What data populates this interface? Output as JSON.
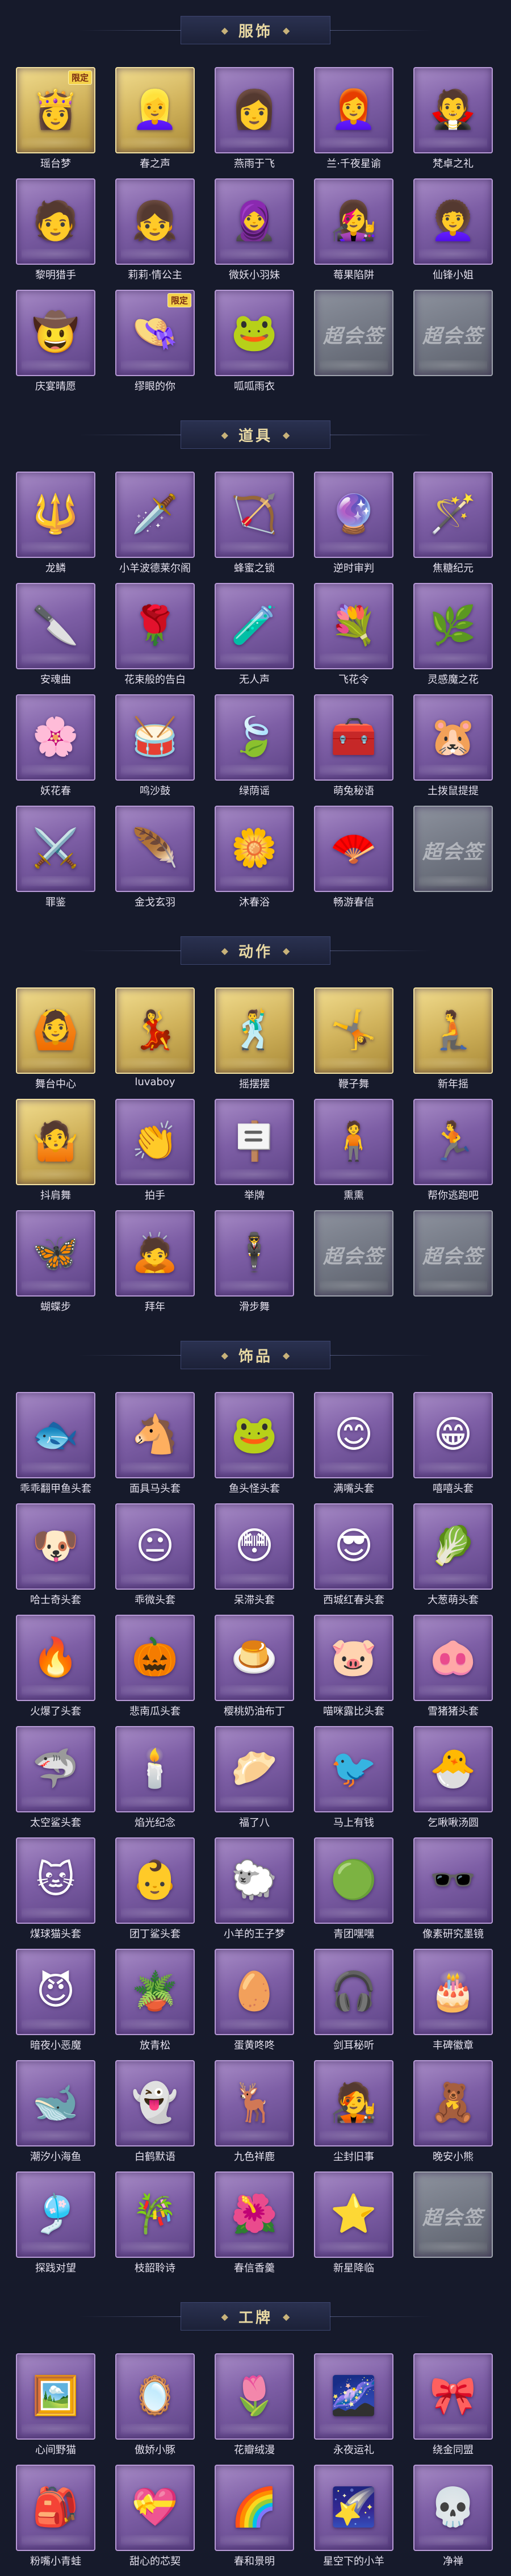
{
  "sections": [
    {
      "title": "服饰",
      "items": [
        {
          "label": "瑶台梦",
          "tier": "gold",
          "badge": "限定",
          "glyph": "👸"
        },
        {
          "label": "春之声",
          "tier": "gold",
          "badge": "",
          "glyph": "👱‍♀️"
        },
        {
          "label": "燕雨于飞",
          "tier": "purple",
          "badge": "",
          "glyph": "👩"
        },
        {
          "label": "兰·千夜星谕",
          "tier": "purple",
          "badge": "",
          "glyph": "👩‍🦰"
        },
        {
          "label": "梵卓之礼",
          "tier": "purple",
          "badge": "",
          "glyph": "🧛"
        },
        {
          "label": "黎明猎手",
          "tier": "purple",
          "badge": "",
          "glyph": "🧑"
        },
        {
          "label": "莉莉·情公主",
          "tier": "purple",
          "badge": "",
          "glyph": "👧"
        },
        {
          "label": "微妖小羽妹",
          "tier": "purple",
          "badge": "",
          "glyph": "🧕"
        },
        {
          "label": "莓果陷阱",
          "tier": "purple",
          "badge": "",
          "glyph": "👩‍🎤"
        },
        {
          "label": "仙锋小姐",
          "tier": "purple",
          "badge": "",
          "glyph": "👩‍🦱"
        },
        {
          "label": "庆宴晴愿",
          "tier": "purple",
          "badge": "",
          "glyph": "🤠"
        },
        {
          "label": "缪眼的你",
          "tier": "purple",
          "badge": "限定",
          "glyph": "👒"
        },
        {
          "label": "呱呱雨衣",
          "tier": "purple",
          "badge": "",
          "glyph": "🐸"
        },
        {
          "label": "",
          "tier": "empty",
          "badge": "",
          "glyph": ""
        },
        {
          "label": "",
          "tier": "empty",
          "badge": "",
          "glyph": ""
        }
      ]
    },
    {
      "title": "道具",
      "items": [
        {
          "label": "龙鳞",
          "tier": "purple",
          "badge": "",
          "glyph": "🔱"
        },
        {
          "label": "小羊波德莱尔阁",
          "tier": "purple",
          "badge": "",
          "glyph": "🗡️"
        },
        {
          "label": "蜂蜜之锁",
          "tier": "purple",
          "badge": "",
          "glyph": "🏹"
        },
        {
          "label": "逆时审判",
          "tier": "purple",
          "badge": "",
          "glyph": "🔮"
        },
        {
          "label": "焦糖纪元",
          "tier": "purple",
          "badge": "",
          "glyph": "🪄"
        },
        {
          "label": "安魂曲",
          "tier": "purple",
          "badge": "",
          "glyph": "🔪"
        },
        {
          "label": "花束般的告白",
          "tier": "purple",
          "badge": "",
          "glyph": "🌹"
        },
        {
          "label": "无人声",
          "tier": "purple",
          "badge": "",
          "glyph": "🧪"
        },
        {
          "label": "飞花令",
          "tier": "purple",
          "badge": "",
          "glyph": "💐"
        },
        {
          "label": "灵感魔之花",
          "tier": "purple",
          "badge": "",
          "glyph": "🌿"
        },
        {
          "label": "妖花春",
          "tier": "purple",
          "badge": "",
          "glyph": "🌸"
        },
        {
          "label": "鸣沙鼓",
          "tier": "purple",
          "badge": "",
          "glyph": "🥁"
        },
        {
          "label": "绿荫谣",
          "tier": "purple",
          "badge": "",
          "glyph": "🍃"
        },
        {
          "label": "萌兔秘语",
          "tier": "purple",
          "badge": "",
          "glyph": "🧰"
        },
        {
          "label": "土拨鼠提提",
          "tier": "purple",
          "badge": "",
          "glyph": "🐹"
        },
        {
          "label": "罪鉴",
          "tier": "purple",
          "badge": "",
          "glyph": "⚔️"
        },
        {
          "label": "金戈玄羽",
          "tier": "purple",
          "badge": "",
          "glyph": "🪶"
        },
        {
          "label": "沐春浴",
          "tier": "purple",
          "badge": "",
          "glyph": "🌼"
        },
        {
          "label": "畅游春信",
          "tier": "purple",
          "badge": "",
          "glyph": "🪭"
        },
        {
          "label": "",
          "tier": "empty",
          "badge": "",
          "glyph": ""
        }
      ]
    },
    {
      "title": "动作",
      "items": [
        {
          "label": "舞台中心",
          "tier": "gold",
          "badge": "",
          "glyph": "🙆"
        },
        {
          "label": "luvaboy",
          "tier": "gold",
          "badge": "",
          "glyph": "💃"
        },
        {
          "label": "摇摆摆",
          "tier": "gold",
          "badge": "",
          "glyph": "🕺"
        },
        {
          "label": "鞭子舞",
          "tier": "gold",
          "badge": "",
          "glyph": "🤸"
        },
        {
          "label": "新年摇",
          "tier": "gold",
          "badge": "",
          "glyph": "🧎"
        },
        {
          "label": "抖肩舞",
          "tier": "gold",
          "badge": "",
          "glyph": "🤷"
        },
        {
          "label": "拍手",
          "tier": "purple",
          "badge": "",
          "glyph": "👏"
        },
        {
          "label": "举牌",
          "tier": "purple",
          "badge": "",
          "glyph": "🪧"
        },
        {
          "label": "熏熏",
          "tier": "purple",
          "badge": "",
          "glyph": "🧍"
        },
        {
          "label": "帮你逃跑吧",
          "tier": "purple",
          "badge": "",
          "glyph": "🏃"
        },
        {
          "label": "蝴蝶步",
          "tier": "purple",
          "badge": "",
          "glyph": "🦋"
        },
        {
          "label": "拜年",
          "tier": "purple",
          "badge": "",
          "glyph": "🙇"
        },
        {
          "label": "滑步舞",
          "tier": "purple",
          "badge": "",
          "glyph": "🕴️"
        },
        {
          "label": "",
          "tier": "empty",
          "badge": "",
          "glyph": ""
        },
        {
          "label": "",
          "tier": "empty",
          "badge": "",
          "glyph": ""
        }
      ]
    },
    {
      "title": "饰品",
      "items": [
        {
          "label": "乖乖翻甲鱼头套",
          "tier": "purple",
          "badge": "",
          "glyph": "🐟"
        },
        {
          "label": "面具马头套",
          "tier": "purple",
          "badge": "",
          "glyph": "🐴"
        },
        {
          "label": "鱼头怪头套",
          "tier": "purple",
          "badge": "",
          "glyph": "🐸"
        },
        {
          "label": "满嘴头套",
          "tier": "purple",
          "badge": "",
          "glyph": "😊"
        },
        {
          "label": "嘻嘻头套",
          "tier": "purple",
          "badge": "",
          "glyph": "😁"
        },
        {
          "label": "哈士奇头套",
          "tier": "purple",
          "badge": "",
          "glyph": "🐶"
        },
        {
          "label": "乖微头套",
          "tier": "purple",
          "badge": "",
          "glyph": "😐"
        },
        {
          "label": "呆滞头套",
          "tier": "purple",
          "badge": "",
          "glyph": "😳"
        },
        {
          "label": "西城红春头套",
          "tier": "purple",
          "badge": "",
          "glyph": "😎"
        },
        {
          "label": "大葱萌头套",
          "tier": "purple",
          "badge": "",
          "glyph": "🥬"
        },
        {
          "label": "火爆了头套",
          "tier": "purple",
          "badge": "",
          "glyph": "🔥"
        },
        {
          "label": "悲南瓜头套",
          "tier": "purple",
          "badge": "",
          "glyph": "🎃"
        },
        {
          "label": "樱桃奶油布丁",
          "tier": "purple",
          "badge": "",
          "glyph": "🍮"
        },
        {
          "label": "喵咪露比头套",
          "tier": "purple",
          "badge": "",
          "glyph": "🐷"
        },
        {
          "label": "雪猪猪头套",
          "tier": "purple",
          "badge": "",
          "glyph": "🐽"
        },
        {
          "label": "太空鲨头套",
          "tier": "purple",
          "badge": "",
          "glyph": "🦈"
        },
        {
          "label": "焰光纪念",
          "tier": "purple",
          "badge": "",
          "glyph": "🕯️"
        },
        {
          "label": "福了八",
          "tier": "purple",
          "badge": "",
          "glyph": "🥟"
        },
        {
          "label": "马上有钱",
          "tier": "purple",
          "badge": "",
          "glyph": "🐦"
        },
        {
          "label": "乞啾啾汤圆",
          "tier": "purple",
          "badge": "",
          "glyph": "🐣"
        },
        {
          "label": "煤球猫头套",
          "tier": "purple",
          "badge": "",
          "glyph": "🐱"
        },
        {
          "label": "团丁鲨头套",
          "tier": "purple",
          "badge": "",
          "glyph": "👶"
        },
        {
          "label": "小羊的王子梦",
          "tier": "purple",
          "badge": "",
          "glyph": "🐑"
        },
        {
          "label": "青团嘿嘿",
          "tier": "purple",
          "badge": "",
          "glyph": "🟢"
        },
        {
          "label": "像素研究墨镜",
          "tier": "purple",
          "badge": "",
          "glyph": "🕶️"
        },
        {
          "label": "暗夜小恶魔",
          "tier": "purple",
          "badge": "",
          "glyph": "😈"
        },
        {
          "label": "放青松",
          "tier": "purple",
          "badge": "",
          "glyph": "🪴"
        },
        {
          "label": "蛋黄咚咚",
          "tier": "purple",
          "badge": "",
          "glyph": "🥚"
        },
        {
          "label": "剑耳秘听",
          "tier": "purple",
          "badge": "",
          "glyph": "🎧"
        },
        {
          "label": "丰碑徽章",
          "tier": "purple",
          "badge": "",
          "glyph": "🎂"
        },
        {
          "label": "潮汐小海鱼",
          "tier": "purple",
          "badge": "",
          "glyph": "🐋"
        },
        {
          "label": "白鹤默语",
          "tier": "purple",
          "badge": "",
          "glyph": "👻"
        },
        {
          "label": "九色祥鹿",
          "tier": "purple",
          "badge": "",
          "glyph": "🦌"
        },
        {
          "label": "尘封旧事",
          "tier": "purple",
          "badge": "",
          "glyph": "🧑‍🎤"
        },
        {
          "label": "晚安小熊",
          "tier": "purple",
          "badge": "",
          "glyph": "🧸"
        },
        {
          "label": "探践对望",
          "tier": "purple",
          "badge": "",
          "glyph": "🎐"
        },
        {
          "label": "枝韶聆诗",
          "tier": "purple",
          "badge": "",
          "glyph": "🎋"
        },
        {
          "label": "春信香羹",
          "tier": "purple",
          "badge": "",
          "glyph": "🌺"
        },
        {
          "label": "新星降临",
          "tier": "purple",
          "badge": "",
          "glyph": "⭐"
        },
        {
          "label": "",
          "tier": "empty",
          "badge": "",
          "glyph": ""
        }
      ]
    },
    {
      "title": "工牌",
      "items": [
        {
          "label": "心间野猫",
          "tier": "purple",
          "badge": "",
          "glyph": "🖼️"
        },
        {
          "label": "傲娇小豚",
          "tier": "purple",
          "badge": "",
          "glyph": "🪞"
        },
        {
          "label": "花瓣绒漫",
          "tier": "purple",
          "badge": "",
          "glyph": "🌷"
        },
        {
          "label": "永夜运礼",
          "tier": "purple",
          "badge": "",
          "glyph": "🌌"
        },
        {
          "label": "绕金同盟",
          "tier": "purple",
          "badge": "",
          "glyph": "🎀"
        },
        {
          "label": "粉嘴小青蛙",
          "tier": "purple",
          "badge": "",
          "glyph": "🎒"
        },
        {
          "label": "甜心的芯契",
          "tier": "purple",
          "badge": "",
          "glyph": "💝"
        },
        {
          "label": "春和景明",
          "tier": "purple",
          "badge": "",
          "glyph": "🌈"
        },
        {
          "label": "星空下的小羊",
          "tier": "purple",
          "badge": "",
          "glyph": "🌠"
        },
        {
          "label": "净禅",
          "tier": "purple",
          "badge": "",
          "glyph": "💀"
        }
      ]
    }
  ],
  "empty_text": "超会签"
}
